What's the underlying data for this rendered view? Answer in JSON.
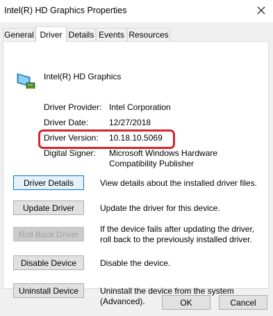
{
  "window": {
    "title": "Intel(R) HD Graphics Properties"
  },
  "tabs": [
    {
      "label": "General",
      "active": false
    },
    {
      "label": "Driver",
      "active": true
    },
    {
      "label": "Details",
      "active": false
    },
    {
      "label": "Events",
      "active": false
    },
    {
      "label": "Resources",
      "active": false
    }
  ],
  "device": {
    "name": "Intel(R) HD Graphics",
    "icon": "display-adapter-icon"
  },
  "info": [
    {
      "label": "Driver Provider:",
      "value": "Intel Corporation"
    },
    {
      "label": "Driver Date:",
      "value": "12/27/2018"
    },
    {
      "label": "Driver Version:",
      "value": "10.18.10.5069"
    },
    {
      "label": "Digital Signer:",
      "value": "Microsoft Windows Hardware Compatibility Publisher"
    }
  ],
  "actions": [
    {
      "button": "Driver Details",
      "description": "View details about the installed driver files.",
      "state": "focused"
    },
    {
      "button": "Update Driver",
      "description": "Update the driver for this device.",
      "state": "normal"
    },
    {
      "button": "Roll Back Driver",
      "description": "If the device fails after updating the driver, roll back to the previously installed driver.",
      "state": "disabled"
    },
    {
      "button": "Disable Device",
      "description": "Disable the device.",
      "state": "normal"
    },
    {
      "button": "Uninstall Device",
      "description": "Uninstall the device from the system (Advanced).",
      "state": "normal"
    }
  ],
  "footer": {
    "ok_label": "OK",
    "cancel_label": "Cancel"
  },
  "colors": {
    "highlight": "#d6252c",
    "focus_border": "#0078d7",
    "dialog_bg": "#f0f0f0"
  }
}
